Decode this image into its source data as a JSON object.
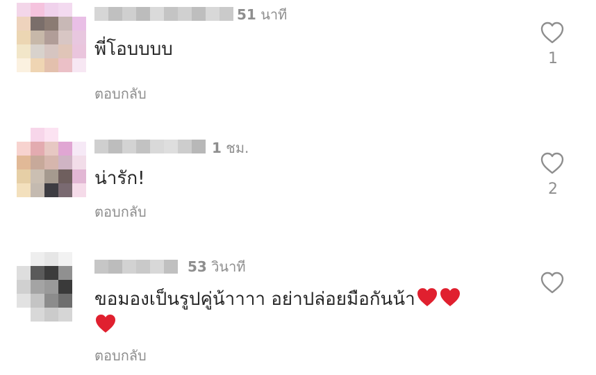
{
  "comments": [
    {
      "time_num": "51",
      "time_unit": "นาที",
      "text": "พี่โอบบบบ",
      "reply": "ตอบกลับ",
      "like_count": "1",
      "avatar": [
        "#f3d6e9",
        "#f5c3de",
        "#f0d2ec",
        "#f3daf0",
        "#ffffff",
        "#eed3bd",
        "#7a6e6a",
        "#8b7b73",
        "#c8b8b6",
        "#e9bfe6",
        "#ecd6b3",
        "#c7b8a9",
        "#b19d98",
        "#d8c6c4",
        "#e8c7df",
        "#f2e6c9",
        "#d8d2cc",
        "#d6c5c1",
        "#e0c5b8",
        "#eac5dd",
        "#fbf1e0",
        "#efd5b3",
        "#e3c0ad",
        "#ebc0c7",
        "#f7e7f3"
      ]
    },
    {
      "time_num": "1",
      "time_unit": "ชม.",
      "text": "น่ารัก!",
      "reply": "ตอบกลับ",
      "like_count": "2",
      "avatar": [
        "#ffffff",
        "#f7d6ea",
        "#fce3f2",
        "#ffffff",
        "#ffffff",
        "#f7d3cf",
        "#e3abb0",
        "#e7c8c3",
        "#e0a6d3",
        "#f6e9f6",
        "#e1b997",
        "#c7a99a",
        "#d6b6ad",
        "#cfb4c4",
        "#f2dde9",
        "#e6cfa6",
        "#cbbfb2",
        "#a59a8f",
        "#6f5f5e",
        "#e2b7d4",
        "#f3e0bd",
        "#c4bab0",
        "#3d3c42",
        "#7a6a71",
        "#f5dbe9"
      ]
    },
    {
      "time_num": "53",
      "time_unit": "วินาที",
      "text": "ขอมองเป็นรูปคู่น้าาาา อย่าปล่อยมือกันน้า",
      "reply": "ตอบกลับ",
      "like_count": "",
      "avatar": [
        "#ffffff",
        "#eeeeee",
        "#e6e6e6",
        "#f2f2f2",
        "#ffffff",
        "#dedede",
        "#5a5a5a",
        "#3c3c3c",
        "#909090",
        "#ffffff",
        "#d0d0d0",
        "#a4a4a4",
        "#9a9a9a",
        "#3a3a3a",
        "#ffffff",
        "#e2e2e2",
        "#c4c4c4",
        "#8c8c8c",
        "#6e6e6e",
        "#ffffff",
        "#ffffff",
        "#d8d8d8",
        "#cbcbcb",
        "#d6d6d6",
        "#ffffff"
      ]
    }
  ],
  "colors": {
    "heart_emoji": "#e0202f",
    "muted_text": "#8e8e8e",
    "body_text": "#262626"
  },
  "icons": {
    "like": "heart-outline-icon",
    "emoji": "red-heart-emoji"
  }
}
